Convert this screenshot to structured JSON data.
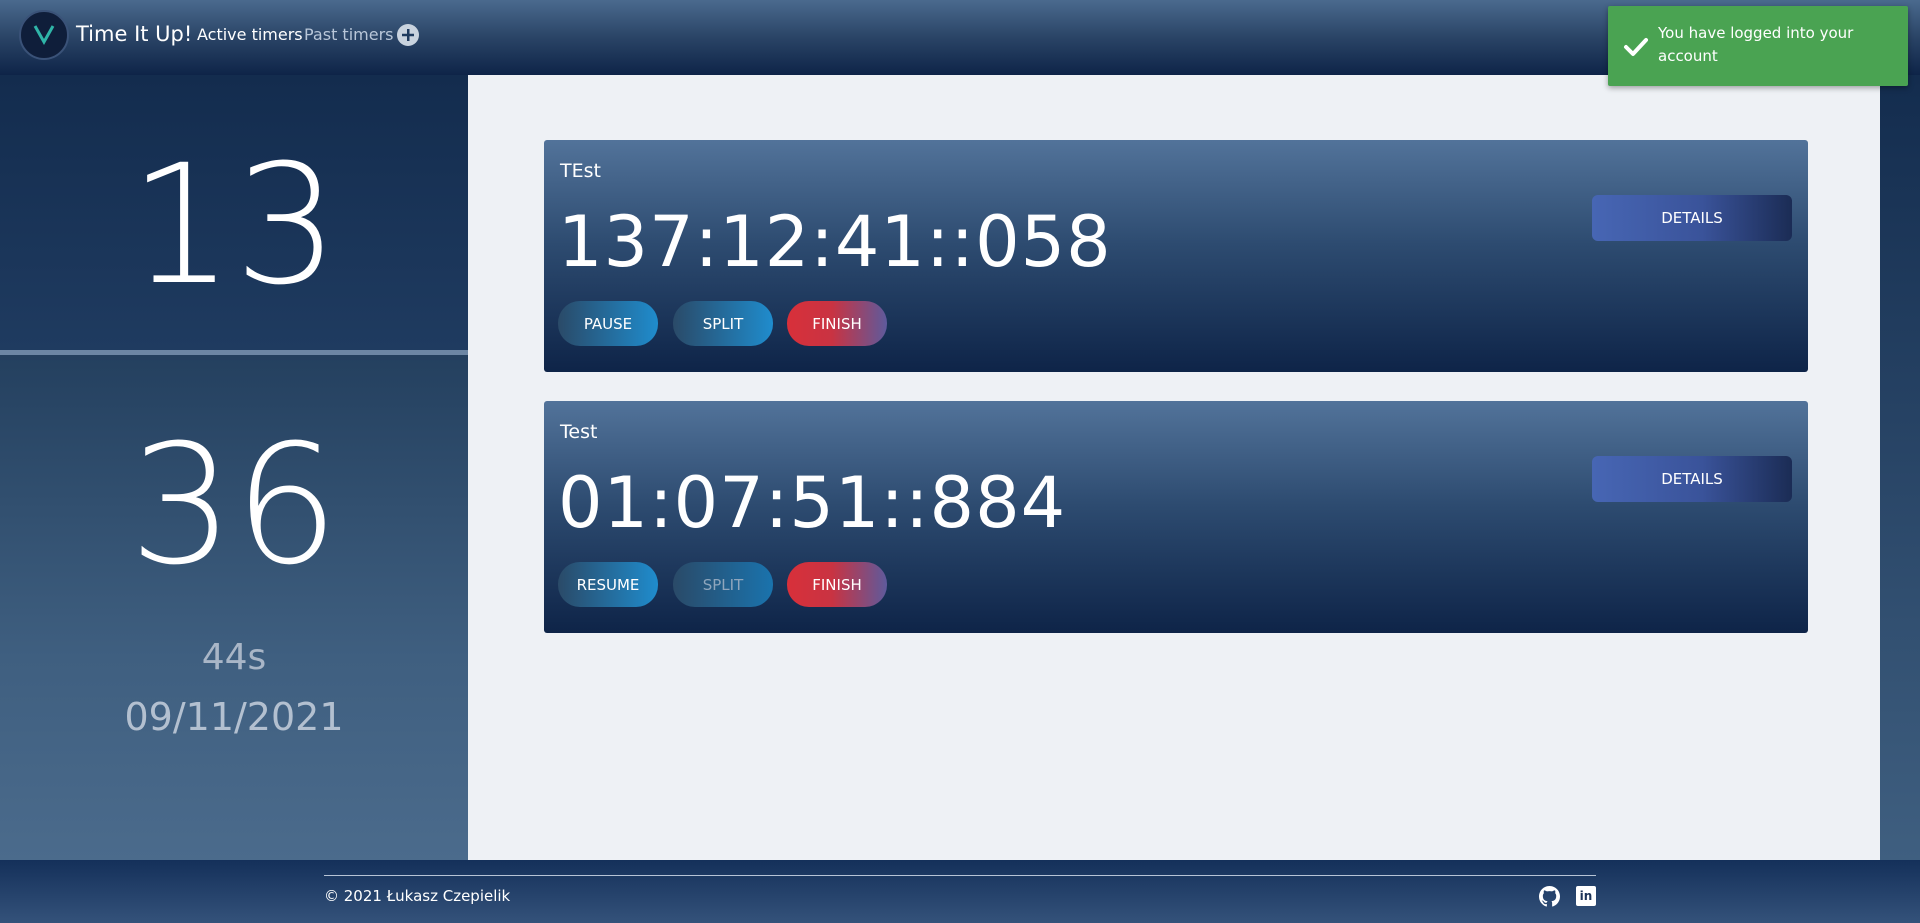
{
  "navbar": {
    "brand": "Time It Up!",
    "links": [
      {
        "label": "Active timers",
        "active": true
      },
      {
        "label": "Past timers",
        "active": false
      }
    ]
  },
  "sidebar": {
    "hours": "13",
    "minutes": "36",
    "seconds": "44s",
    "date": "09/11/2021"
  },
  "timers": [
    {
      "name": "TEst",
      "value": "137:12:41::058",
      "primary_action": "PAUSE",
      "split": "SPLIT",
      "finish": "FINISH",
      "details": "DETAILS"
    },
    {
      "name": "Test",
      "value": "01:07:51::884",
      "primary_action": "RESUME",
      "split": "SPLIT",
      "finish": "FINISH",
      "details": "DETAILS"
    }
  ],
  "toast": {
    "message": "You have logged into your account",
    "icon": "checkmark-icon",
    "color": "#4aa352"
  },
  "footer": {
    "copyright": "© 2021 Łukasz Czepielik",
    "icons": [
      "github-icon",
      "linkedin-icon"
    ]
  },
  "colors": {
    "background": "#eef1f5",
    "navbar": "#1e3a5f",
    "finish_red": "#d8303a",
    "split_blue": "#1f8ccd"
  }
}
